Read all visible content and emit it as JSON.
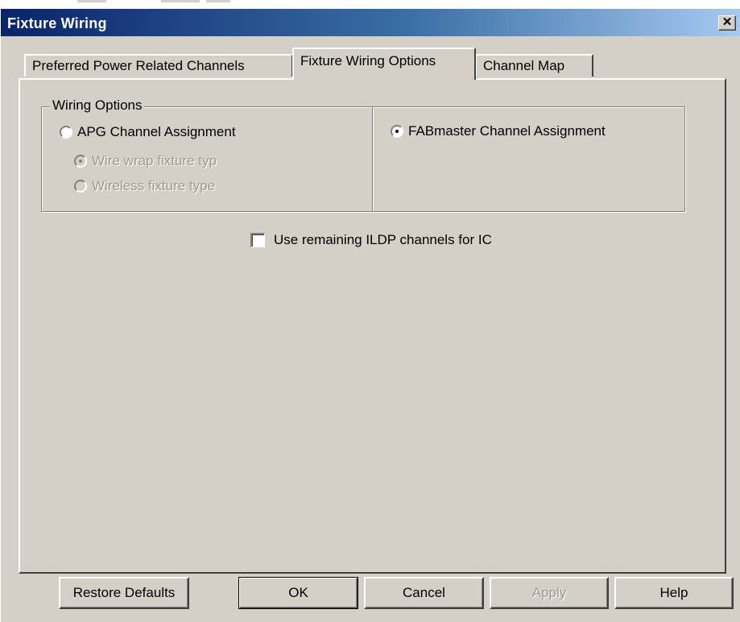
{
  "window": {
    "title": "Fixture Wiring",
    "close_glyph": "✕",
    "close_icon": "close-icon"
  },
  "tabs": [
    {
      "label": "Preferred Power Related Channels",
      "active": false
    },
    {
      "label": "Fixture Wiring Options",
      "active": true
    },
    {
      "label": "Channel Map",
      "active": false
    }
  ],
  "wiring_options": {
    "group_label": "Wiring Options",
    "apg": {
      "label": "APG Channel Assignment",
      "selected": false
    },
    "wire_wrap": {
      "label": "Wire wrap fixture typ",
      "selected": true,
      "enabled": false
    },
    "wireless": {
      "label": "Wireless fixture type",
      "selected": false,
      "enabled": false
    },
    "fabmaster": {
      "label": "FABmaster Channel Assignment",
      "selected": true
    }
  },
  "ildp_checkbox": {
    "label": "Use remaining ILDP channels for IC",
    "checked": false
  },
  "buttons": {
    "restore_defaults": "Restore Defaults",
    "ok": "OK",
    "cancel": "Cancel",
    "apply": "Apply",
    "help": "Help"
  },
  "colors": {
    "face": "#d4d0c8",
    "title_gradient_start": "#0a246a",
    "title_gradient_end": "#a6caf0",
    "disabled_text": "#9d9a92"
  }
}
